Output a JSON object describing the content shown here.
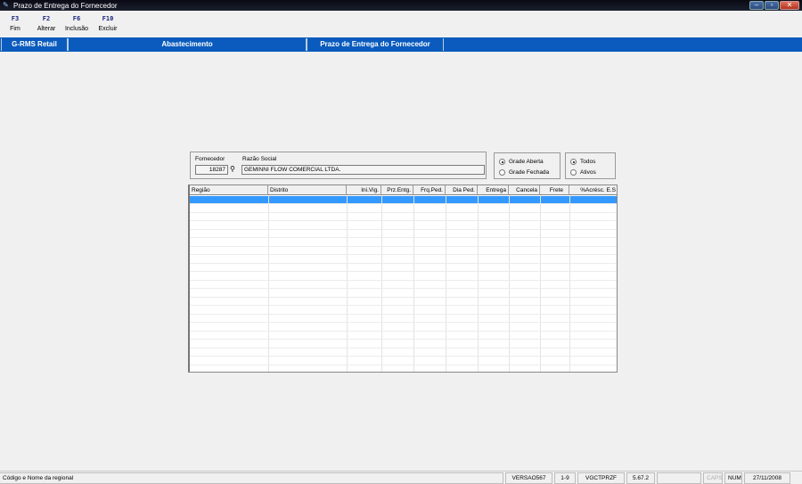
{
  "window": {
    "title": "Prazo de Entrega do Fornecedor"
  },
  "fkeys": [
    {
      "key": "F3",
      "label": "Fim"
    },
    {
      "key": "F2",
      "label": "Alterar"
    },
    {
      "key": "F6",
      "label": "Inclusão"
    },
    {
      "key": "F10",
      "label": "Excluir"
    }
  ],
  "modules": [
    "G-RMS Retail",
    "Abastecimento",
    "Prazo de Entrega do Fornecedor"
  ],
  "form": {
    "fornecedor_label": "Fornecedor",
    "fornecedor_value": "18287",
    "razao_label": "Razão Social",
    "razao_value": "GEMINNI FLOW COMERCIAL LTDA."
  },
  "grade_options": [
    {
      "label": "Grade Aberta",
      "selected": true
    },
    {
      "label": "Grade Fechada",
      "selected": false
    }
  ],
  "filter_options": [
    {
      "label": "Todos",
      "selected": true
    },
    {
      "label": "Ativos",
      "selected": false
    }
  ],
  "grid": {
    "columns": [
      "Região",
      "Distrito",
      "Ini.Vig.",
      "Prz.Entg.",
      "Frq.Ped.",
      "Dia Ped.",
      "Entrega",
      "Cancela",
      "Frete",
      "%Acrésc. E.S"
    ]
  },
  "status": {
    "hint": "Código e Nome da regional",
    "version": "VERSAO567",
    "page": "1-9",
    "program": "VGCTPRZF",
    "build": "5.67.2",
    "caps": "CAPS",
    "num": "NUM",
    "date": "27/11/2008"
  }
}
